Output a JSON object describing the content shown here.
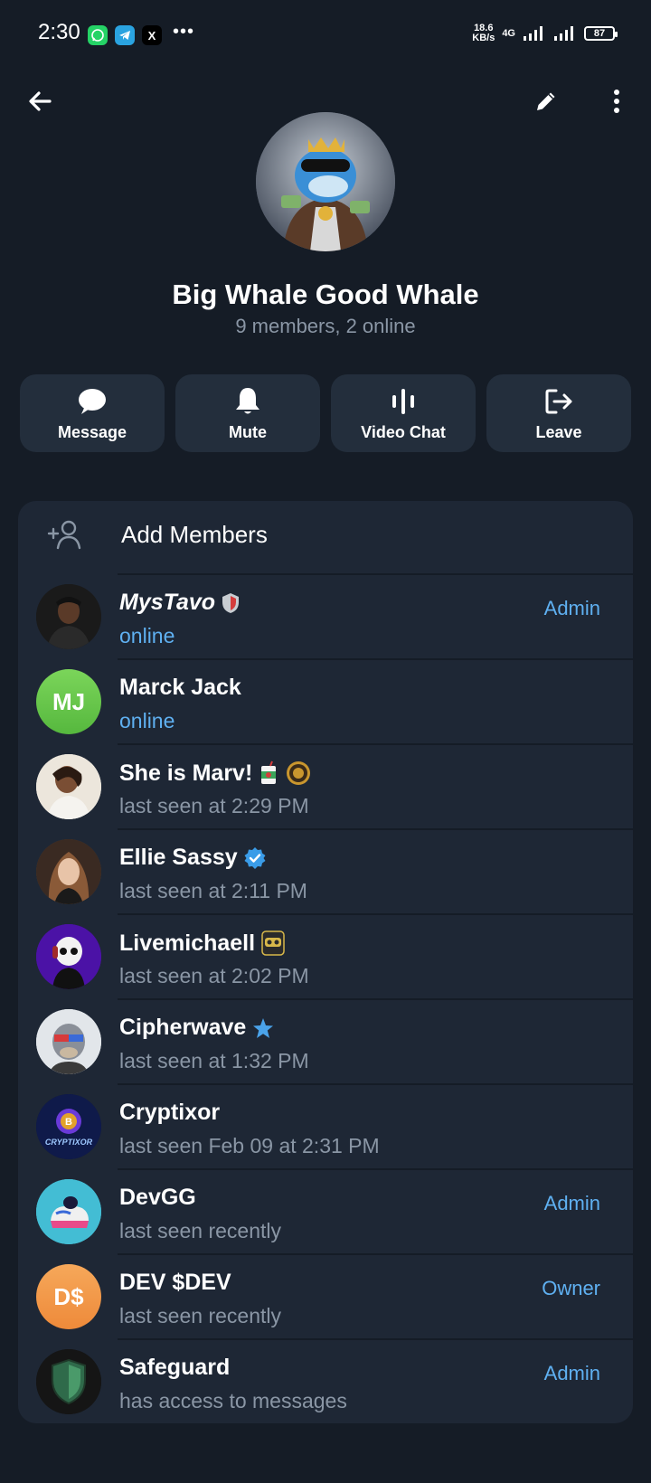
{
  "status_bar": {
    "time": "2:30",
    "speed_value": "18.6",
    "speed_unit": "KB/s",
    "network": "4G",
    "battery": "87",
    "apps": [
      "whatsapp-icon",
      "telegram-icon",
      "x-icon"
    ],
    "more": "•••"
  },
  "header": {
    "back_icon": "arrow-left-icon",
    "edit_icon": "pencil-icon",
    "menu_icon": "more-vertical-icon"
  },
  "group": {
    "title": "Big Whale Good Whale",
    "subtitle": "9 members, 2 online"
  },
  "actions": [
    {
      "label": "Message",
      "icon": "chat-bubble-icon"
    },
    {
      "label": "Mute",
      "icon": "bell-icon"
    },
    {
      "label": "Video Chat",
      "icon": "voice-wave-icon"
    },
    {
      "label": "Leave",
      "icon": "logout-icon"
    }
  ],
  "add_members": {
    "label": "Add Members",
    "icon": "add-user-icon"
  },
  "members": [
    {
      "name": "MysTavo",
      "status": "online",
      "role": "Admin",
      "online": true
    },
    {
      "name": "Marck Jack",
      "initials": "MJ",
      "status": "online",
      "role": "",
      "online": true
    },
    {
      "name": "She is Marv!",
      "status": "last seen at 2:29 PM",
      "role": ""
    },
    {
      "name": "Ellie Sassy",
      "status": "last seen at 2:11 PM",
      "role": ""
    },
    {
      "name": "Livemichaell",
      "status": "last seen at 2:02 PM",
      "role": ""
    },
    {
      "name": "Cipherwave",
      "status": "last seen at 1:32 PM",
      "role": ""
    },
    {
      "name": "Cryptixor",
      "status": "last seen Feb 09 at 2:31 PM",
      "role": "",
      "avatar_text": "CRYPTIXOR"
    },
    {
      "name": "DevGG",
      "status": "last seen recently",
      "role": "Admin"
    },
    {
      "name": "DEV $DEV",
      "initials": "D$",
      "status": "last seen recently",
      "role": "Owner"
    },
    {
      "name": "Safeguard",
      "status": "has access to messages",
      "role": "Admin"
    }
  ],
  "colors": {
    "background": "#151c26",
    "card": "#1e2735",
    "accent": "#5fb0f1",
    "secondary_text": "#8a96a5"
  }
}
